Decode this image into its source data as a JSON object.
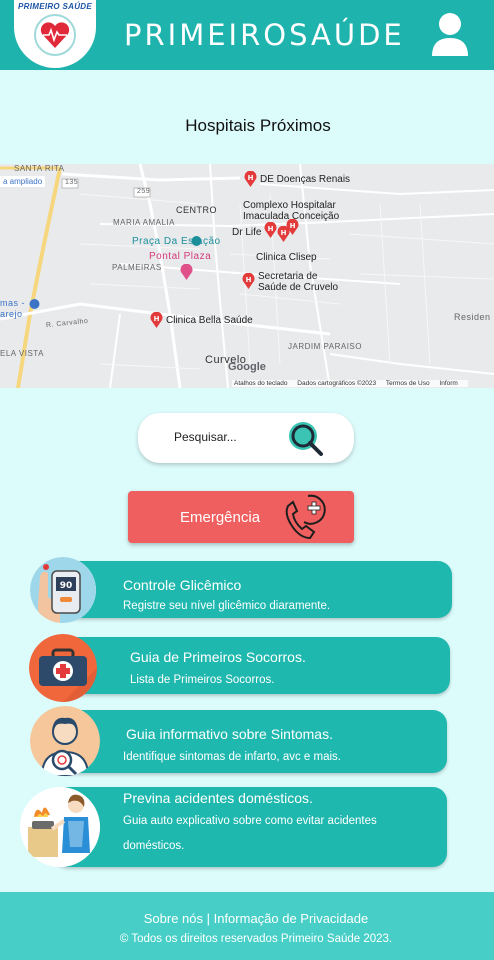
{
  "header": {
    "logo_text": "PRIMEIRO SAÚDE",
    "brand": "PRIMEIROSAÚDE",
    "accent_color": "#1fb3ad"
  },
  "section_title": "Hospitais Próximos",
  "map": {
    "expand_label": "a ampliado",
    "labels": {
      "santa_rita": "SANTA RITA",
      "road_135": "135",
      "road_259": "259",
      "centro": "CENTRO",
      "maria_amalia": "MARIA AMALIA",
      "palmeiras": "PALMEIRAS",
      "praca": "Praça Da Estação",
      "pontal": "Pontal Plaza",
      "carrefour": "mas -\narejo",
      "carvalho": "R. Carvalho",
      "bela_vista": "ELA VISTA",
      "curvelo": "Curvelo",
      "jardim": "JARDIM PARAISO",
      "resid": "Residen"
    },
    "hospitals": {
      "doencas_renais": "DE Doenças Renais",
      "imaculada": "Complexo Hospitalar\nImaculada Conceição",
      "dr_life": "Dr Life",
      "clisep": "Clinica Clisep",
      "secretaria": "Secretaria de\nSaúde de Cruvelo",
      "bella": "Clinica Bella Saúde"
    },
    "attribution": [
      "Atalhos do teclado",
      "Dados cartográficos ©2023",
      "Termos de Uso",
      "Inform"
    ],
    "google": "Google"
  },
  "search": {
    "placeholder": "Pesquisar..."
  },
  "emergency": {
    "label": "Emergência",
    "color": "#f05f5f"
  },
  "cards": [
    {
      "title": "Controle Glicêmico",
      "subtitle": "Registre seu nível glicêmico diaramente.",
      "meter_value": "90"
    },
    {
      "title": "Guia de Primeiros Socorros.",
      "subtitle": "Lista de Primeiros Socorros."
    },
    {
      "title": "Guia informativo sobre Sintomas.",
      "subtitle": "Identifique sintomas de infarto, avc e mais."
    },
    {
      "title": "Previna acidentes domésticos.",
      "subtitle": "Guia auto explicativo sobre como evitar acidentes domésticos."
    }
  ],
  "footer": {
    "links": "Sobre nós | Informação de Privacidade",
    "copyright": "© Todos os direitos reservados Primeiro Saúde 2023."
  },
  "icons": [
    "heart-logo-icon",
    "user-icon",
    "search-icon",
    "phone-emergency-icon",
    "glucose-meter-icon",
    "first-aid-kit-icon",
    "doctor-icon",
    "cooking-icon"
  ]
}
